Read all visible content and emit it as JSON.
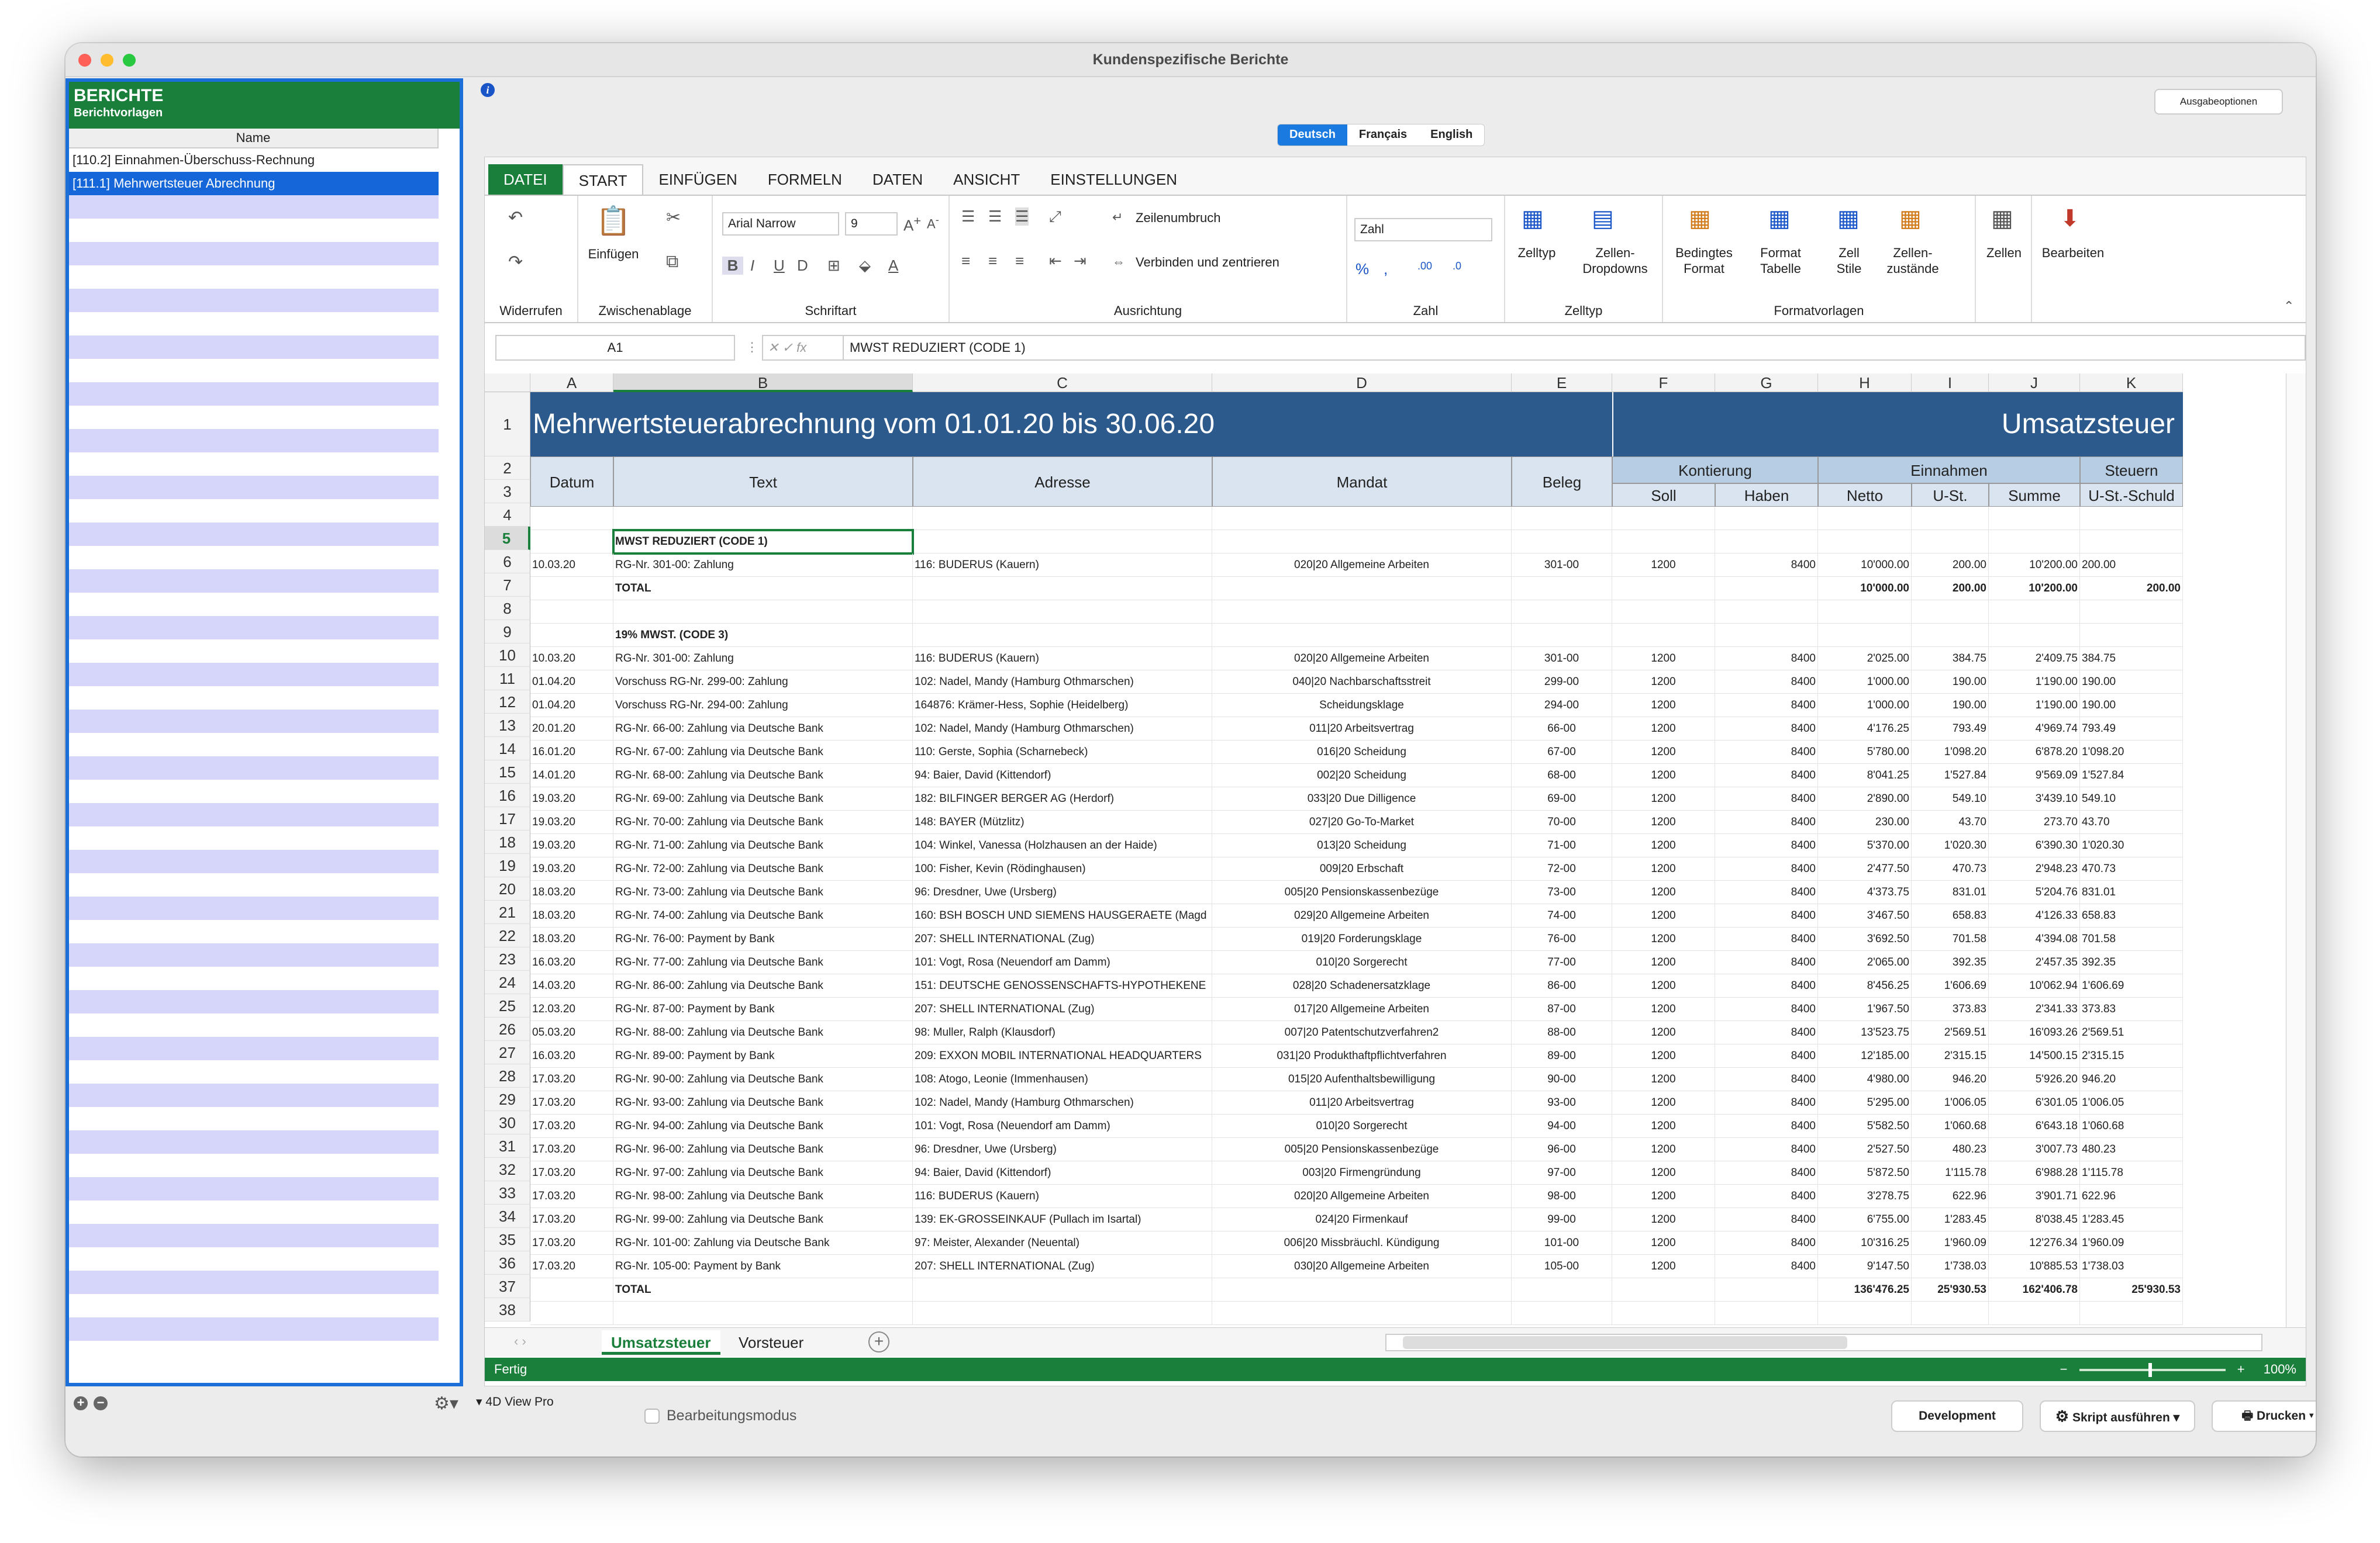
{
  "window": {
    "title": "Kundenspezifische Berichte"
  },
  "left_panel": {
    "title": "BERICHTE",
    "subtitle": "Berichtvorlagen",
    "column_header": "Name",
    "items": [
      "[110.2] Einnahmen-Überschuss-Rechnung",
      "[111.1] Mehrwertsteuer Abrechnung"
    ]
  },
  "toolbar": {
    "output_options": "Ausgabeoptionen"
  },
  "languages": [
    "Deutsch",
    "Français",
    "English"
  ],
  "ribbon": {
    "tabs": [
      "DATEI",
      "START",
      "EINFÜGEN",
      "FORMELN",
      "DATEN",
      "ANSICHT",
      "EINSTELLUNGEN"
    ],
    "groups": {
      "undo": "Widerrufen",
      "clipboard": "Zwischenablage",
      "font": "Schriftart",
      "alignment": "Ausrichtung",
      "number": "Zahl",
      "celltype": "Zelltyp",
      "styles": "Formatvorlagen"
    },
    "paste_label": "Einfügen",
    "font_name": "Arial Narrow",
    "font_size": "9",
    "wrap_text": "Zeilenumbruch",
    "merge_center": "Verbinden und zentrieren",
    "number_format": "Zahl",
    "celltype_label": "Zelltyp",
    "cell_dropdowns_label": "Zellen-Dropdowns",
    "conditional_format": "Bedingtes Format",
    "format_table": "Format Tabelle",
    "cell_styles": "Zell Stile",
    "cell_states": "Zellen-zustände",
    "cells_label": "Zellen",
    "edit_label": "Bearbeiten"
  },
  "formula_bar": {
    "name_box": "A1",
    "formula": "MWST REDUZIERT (CODE 1)"
  },
  "columns": [
    "A",
    "B",
    "C",
    "D",
    "E",
    "F",
    "G",
    "H",
    "I",
    "J",
    "K"
  ],
  "sheet": {
    "title": "Mehrwertsteuerabrechnung vom 01.01.20 bis 30.06.20",
    "title_right": "Umsatzsteuer",
    "headers": {
      "datum": "Datum",
      "text": "Text",
      "adresse": "Adresse",
      "mandat": "Mandat",
      "beleg": "Beleg",
      "kontierung": "Kontierung",
      "einnahmen": "Einnahmen",
      "steuern": "Steuern",
      "soll": "Soll",
      "haben": "Haben",
      "netto": "Netto",
      "ust": "U-St.",
      "summe": "Summe",
      "ustschuld": "U-St.-Schuld"
    },
    "section1": "MWST REDUZIERT (CODE 1)",
    "section2": "19% MWST. (CODE 3)",
    "total_label": "TOTAL",
    "row6": [
      "10.03.20",
      "RG-Nr. 301-00: Zahlung",
      "116: BUDERUS (Kauern)",
      "020|20 Allgemeine Arbeiten",
      "301-00",
      "1200",
      "8400",
      "10'000.00",
      "200.00",
      "10'200.00",
      "200.00"
    ],
    "total1": [
      "10'000.00",
      "200.00",
      "10'200.00",
      "200.00"
    ],
    "rows": [
      [
        "10.03.20",
        "RG-Nr. 301-00: Zahlung",
        "116: BUDERUS (Kauern)",
        "020|20 Allgemeine Arbeiten",
        "301-00",
        "1200",
        "8400",
        "2'025.00",
        "384.75",
        "2'409.75",
        "384.75"
      ],
      [
        "01.04.20",
        "Vorschuss RG-Nr. 299-00: Zahlung",
        "102: Nadel, Mandy (Hamburg Othmarschen)",
        "040|20 Nachbarschaftsstreit",
        "299-00",
        "1200",
        "8400",
        "1'000.00",
        "190.00",
        "1'190.00",
        "190.00"
      ],
      [
        "01.04.20",
        "Vorschuss RG-Nr. 294-00: Zahlung",
        "164876: Krämer-Hess, Sophie (Heidelberg)",
        "Scheidungsklage",
        "294-00",
        "1200",
        "8400",
        "1'000.00",
        "190.00",
        "1'190.00",
        "190.00"
      ],
      [
        "20.01.20",
        "RG-Nr. 66-00: Zahlung via Deutsche Bank",
        "102: Nadel, Mandy (Hamburg Othmarschen)",
        "011|20 Arbeitsvertrag",
        "66-00",
        "1200",
        "8400",
        "4'176.25",
        "793.49",
        "4'969.74",
        "793.49"
      ],
      [
        "16.01.20",
        "RG-Nr. 67-00: Zahlung via Deutsche Bank",
        "110: Gerste, Sophia (Scharnebeck)",
        "016|20 Scheidung",
        "67-00",
        "1200",
        "8400",
        "5'780.00",
        "1'098.20",
        "6'878.20",
        "1'098.20"
      ],
      [
        "14.01.20",
        "RG-Nr. 68-00: Zahlung via Deutsche Bank",
        "94: Baier, David (Kittendorf)",
        "002|20 Scheidung",
        "68-00",
        "1200",
        "8400",
        "8'041.25",
        "1'527.84",
        "9'569.09",
        "1'527.84"
      ],
      [
        "19.03.20",
        "RG-Nr. 69-00: Zahlung via Deutsche Bank",
        "182: BILFINGER BERGER AG (Herdorf)",
        "033|20 Due Dilligence",
        "69-00",
        "1200",
        "8400",
        "2'890.00",
        "549.10",
        "3'439.10",
        "549.10"
      ],
      [
        "19.03.20",
        "RG-Nr. 70-00: Zahlung via Deutsche Bank",
        "148: BAYER (Mützlitz)",
        "027|20 Go-To-Market",
        "70-00",
        "1200",
        "8400",
        "230.00",
        "43.70",
        "273.70",
        "43.70"
      ],
      [
        "19.03.20",
        "RG-Nr. 71-00: Zahlung via Deutsche Bank",
        "104: Winkel, Vanessa (Holzhausen an der Haide)",
        "013|20 Scheidung",
        "71-00",
        "1200",
        "8400",
        "5'370.00",
        "1'020.30",
        "6'390.30",
        "1'020.30"
      ],
      [
        "19.03.20",
        "RG-Nr. 72-00: Zahlung via Deutsche Bank",
        "100: Fisher, Kevin (Rödinghausen)",
        "009|20 Erbschaft",
        "72-00",
        "1200",
        "8400",
        "2'477.50",
        "470.73",
        "2'948.23",
        "470.73"
      ],
      [
        "18.03.20",
        "RG-Nr. 73-00: Zahlung via Deutsche Bank",
        "96: Dresdner, Uwe (Ursberg)",
        "005|20 Pensionskassenbezüge",
        "73-00",
        "1200",
        "8400",
        "4'373.75",
        "831.01",
        "5'204.76",
        "831.01"
      ],
      [
        "18.03.20",
        "RG-Nr. 74-00: Zahlung via Deutsche Bank",
        "160: BSH BOSCH UND SIEMENS HAUSGERAETE (Magd",
        "029|20 Allgemeine Arbeiten",
        "74-00",
        "1200",
        "8400",
        "3'467.50",
        "658.83",
        "4'126.33",
        "658.83"
      ],
      [
        "18.03.20",
        "RG-Nr. 76-00: Payment by Bank",
        "207: SHELL INTERNATIONAL (Zug)",
        "019|20 Forderungsklage",
        "76-00",
        "1200",
        "8400",
        "3'692.50",
        "701.58",
        "4'394.08",
        "701.58"
      ],
      [
        "16.03.20",
        "RG-Nr. 77-00: Zahlung via Deutsche Bank",
        "101: Vogt, Rosa (Neuendorf am Damm)",
        "010|20 Sorgerecht",
        "77-00",
        "1200",
        "8400",
        "2'065.00",
        "392.35",
        "2'457.35",
        "392.35"
      ],
      [
        "14.03.20",
        "RG-Nr. 86-00: Zahlung via Deutsche Bank",
        "151: DEUTSCHE GENOSSENSCHAFTS-HYPOTHEKENE",
        "028|20 Schadenersatzklage",
        "86-00",
        "1200",
        "8400",
        "8'456.25",
        "1'606.69",
        "10'062.94",
        "1'606.69"
      ],
      [
        "12.03.20",
        "RG-Nr. 87-00: Payment by Bank",
        "207: SHELL INTERNATIONAL (Zug)",
        "017|20 Allgemeine Arbeiten",
        "87-00",
        "1200",
        "8400",
        "1'967.50",
        "373.83",
        "2'341.33",
        "373.83"
      ],
      [
        "05.03.20",
        "RG-Nr. 88-00: Zahlung via Deutsche Bank",
        "98: Muller, Ralph (Klausdorf)",
        "007|20 Patentschutzverfahren2",
        "88-00",
        "1200",
        "8400",
        "13'523.75",
        "2'569.51",
        "16'093.26",
        "2'569.51"
      ],
      [
        "16.03.20",
        "RG-Nr. 89-00: Payment by Bank",
        "209: EXXON MOBIL INTERNATIONAL HEADQUARTERS",
        "031|20 Produkthaftpflichtverfahren",
        "89-00",
        "1200",
        "8400",
        "12'185.00",
        "2'315.15",
        "14'500.15",
        "2'315.15"
      ],
      [
        "17.03.20",
        "RG-Nr. 90-00: Zahlung via Deutsche Bank",
        "108: Atogo, Leonie (Immenhausen)",
        "015|20 Aufenthaltsbewilligung",
        "90-00",
        "1200",
        "8400",
        "4'980.00",
        "946.20",
        "5'926.20",
        "946.20"
      ],
      [
        "17.03.20",
        "RG-Nr. 93-00: Zahlung via Deutsche Bank",
        "102: Nadel, Mandy (Hamburg Othmarschen)",
        "011|20 Arbeitsvertrag",
        "93-00",
        "1200",
        "8400",
        "5'295.00",
        "1'006.05",
        "6'301.05",
        "1'006.05"
      ],
      [
        "17.03.20",
        "RG-Nr. 94-00: Zahlung via Deutsche Bank",
        "101: Vogt, Rosa (Neuendorf am Damm)",
        "010|20 Sorgerecht",
        "94-00",
        "1200",
        "8400",
        "5'582.50",
        "1'060.68",
        "6'643.18",
        "1'060.68"
      ],
      [
        "17.03.20",
        "RG-Nr. 96-00: Zahlung via Deutsche Bank",
        "96: Dresdner, Uwe (Ursberg)",
        "005|20 Pensionskassenbezüge",
        "96-00",
        "1200",
        "8400",
        "2'527.50",
        "480.23",
        "3'007.73",
        "480.23"
      ],
      [
        "17.03.20",
        "RG-Nr. 97-00: Zahlung via Deutsche Bank",
        "94: Baier, David (Kittendorf)",
        "003|20 Firmengründung",
        "97-00",
        "1200",
        "8400",
        "5'872.50",
        "1'115.78",
        "6'988.28",
        "1'115.78"
      ],
      [
        "17.03.20",
        "RG-Nr. 98-00: Zahlung via Deutsche Bank",
        "116: BUDERUS (Kauern)",
        "020|20 Allgemeine Arbeiten",
        "98-00",
        "1200",
        "8400",
        "3'278.75",
        "622.96",
        "3'901.71",
        "622.96"
      ],
      [
        "17.03.20",
        "RG-Nr. 99-00: Zahlung via Deutsche Bank",
        "139: EK-GROSSEINKAUF (Pullach im Isartal)",
        "024|20 Firmenkauf",
        "99-00",
        "1200",
        "8400",
        "6'755.00",
        "1'283.45",
        "8'038.45",
        "1'283.45"
      ],
      [
        "17.03.20",
        "RG-Nr. 101-00: Zahlung via Deutsche Bank",
        "97: Meister, Alexander (Neuental)",
        "006|20 Missbräuchl. Kündigung",
        "101-00",
        "1200",
        "8400",
        "10'316.25",
        "1'960.09",
        "12'276.34",
        "1'960.09"
      ],
      [
        "17.03.20",
        "RG-Nr. 105-00: Payment by Bank",
        "207: SHELL INTERNATIONAL (Zug)",
        "030|20 Allgemeine Arbeiten",
        "105-00",
        "1200",
        "8400",
        "9'147.50",
        "1'738.03",
        "10'885.53",
        "1'738.03"
      ]
    ],
    "total2": [
      "136'476.25",
      "25'930.53",
      "162'406.78",
      "25'930.53"
    ]
  },
  "sheet_tabs": [
    "Umsatzsteuer",
    "Vorsteuer"
  ],
  "status": {
    "text": "Fertig",
    "zoom": "100%"
  },
  "footer": {
    "view_pro": "4D View Pro",
    "edit_mode": "Bearbeitungsmodus",
    "development": "Development",
    "run_script": "Skript ausführen",
    "print": "Drucken"
  }
}
